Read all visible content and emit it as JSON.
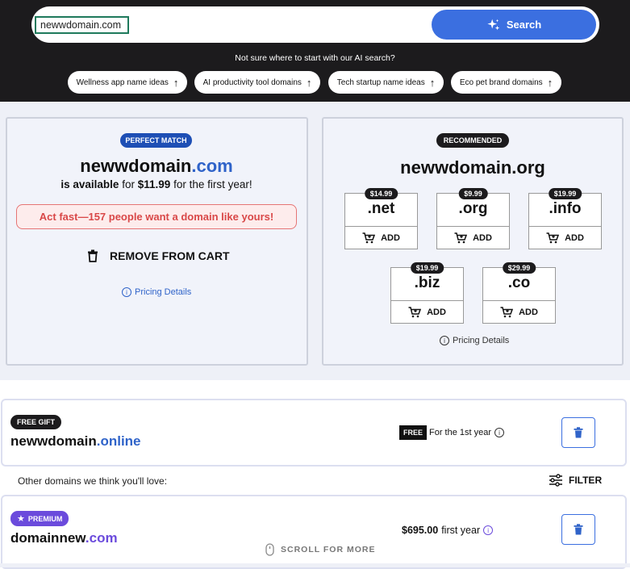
{
  "search": {
    "value": "newwdomain.com",
    "button_label": "Search"
  },
  "ai_hint": "Not sure where to start with our AI search?",
  "suggestions": [
    {
      "label": "Wellness app name ideas"
    },
    {
      "label": "AI productivity tool domains"
    },
    {
      "label": "Tech startup name ideas"
    },
    {
      "label": "Eco pet brand domains"
    }
  ],
  "match": {
    "badge": "PERFECT MATCH",
    "name": "newwdomain",
    "tld": ".com",
    "available_prefix": "is available",
    "available_for": "for",
    "price": "$11.99",
    "price_suffix": "for the first year!",
    "warning": "Act fast—157 people want a domain like yours!",
    "remove_label": "REMOVE FROM CART",
    "pricing_details": "Pricing Details"
  },
  "recommended": {
    "badge": "RECOMMENDED",
    "domain": "newwdomain.org",
    "add_label": "ADD",
    "pricing_details": "Pricing Details",
    "tlds": [
      {
        "name": ".net",
        "price": "$14.99"
      },
      {
        "name": ".org",
        "price": "$9.99"
      },
      {
        "name": ".info",
        "price": "$19.99"
      },
      {
        "name": ".biz",
        "price": "$19.99"
      },
      {
        "name": ".co",
        "price": "$29.99"
      }
    ]
  },
  "gift": {
    "badge": "FREE GIFT",
    "name": "newwdomain",
    "tld": ".online",
    "free_tag": "FREE",
    "free_text": "For the 1st year"
  },
  "others_label": "Other domains we think you'll love:",
  "filter_label": "FILTER",
  "premium": {
    "badge": "PREMIUM",
    "name": "domainnew",
    "tld": ".com",
    "price": "$695.00",
    "price_suffix": "first year"
  },
  "scroll_label": "SCROLL FOR MORE",
  "colors": {
    "accent": "#3b6fe0",
    "dark": "#1c1b1d",
    "warning": "#d94848",
    "premium": "#6b4bdc",
    "domain_tld": "#2f63c9"
  }
}
